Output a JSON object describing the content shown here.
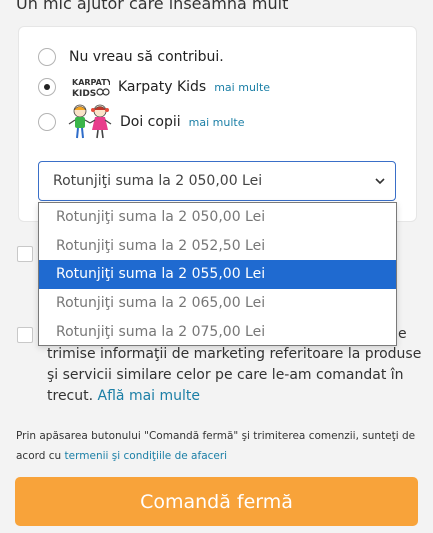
{
  "header": {
    "title": "Un mic ajutor care înseamnă mult"
  },
  "donation": {
    "options": [
      {
        "label": "Nu vreau să contribui.",
        "selected": false
      },
      {
        "label": "Karpaty Kids",
        "more": "mai multe",
        "selected": true,
        "logo": "karpaty-kids-logo"
      },
      {
        "label": "Doi copii",
        "more": "mai multe",
        "selected": false,
        "logo": "doi-copii-logo"
      }
    ],
    "select": {
      "value": "Rotunjiţi suma la 2 050,00 Lei",
      "options": [
        "Rotunjiţi suma la 2 050,00 Lei",
        "Rotunjiţi suma la 2 052,50 Lei",
        "Rotunjiţi suma la 2 055,00 Lei",
        "Rotunjiţi suma la 2 065,00 Lei",
        "Rotunjiţi suma la 2 075,00 Lei"
      ],
      "highlighted_index": 2
    }
  },
  "marketing": {
    "tail": "e",
    "line1": "trimise informaţii de marketing referitoare la produse",
    "line2": "şi servicii similare celor pe care le-am comandat în",
    "line3_prefix": "trecut. ",
    "link": "Află mai multe"
  },
  "terms": {
    "text": "Prin apăsarea butonului \"Comandă fermă\" şi trimiterea comenzii, sunteţi de acord cu ",
    "link": "termenii şi condiţiile de afaceri"
  },
  "cta": {
    "label": "Comandă fermă"
  },
  "colors": {
    "accent": "#f8a33a",
    "link": "#1b7fa6",
    "select_border": "#3a6fc8",
    "highlight": "#1f6ad0"
  }
}
